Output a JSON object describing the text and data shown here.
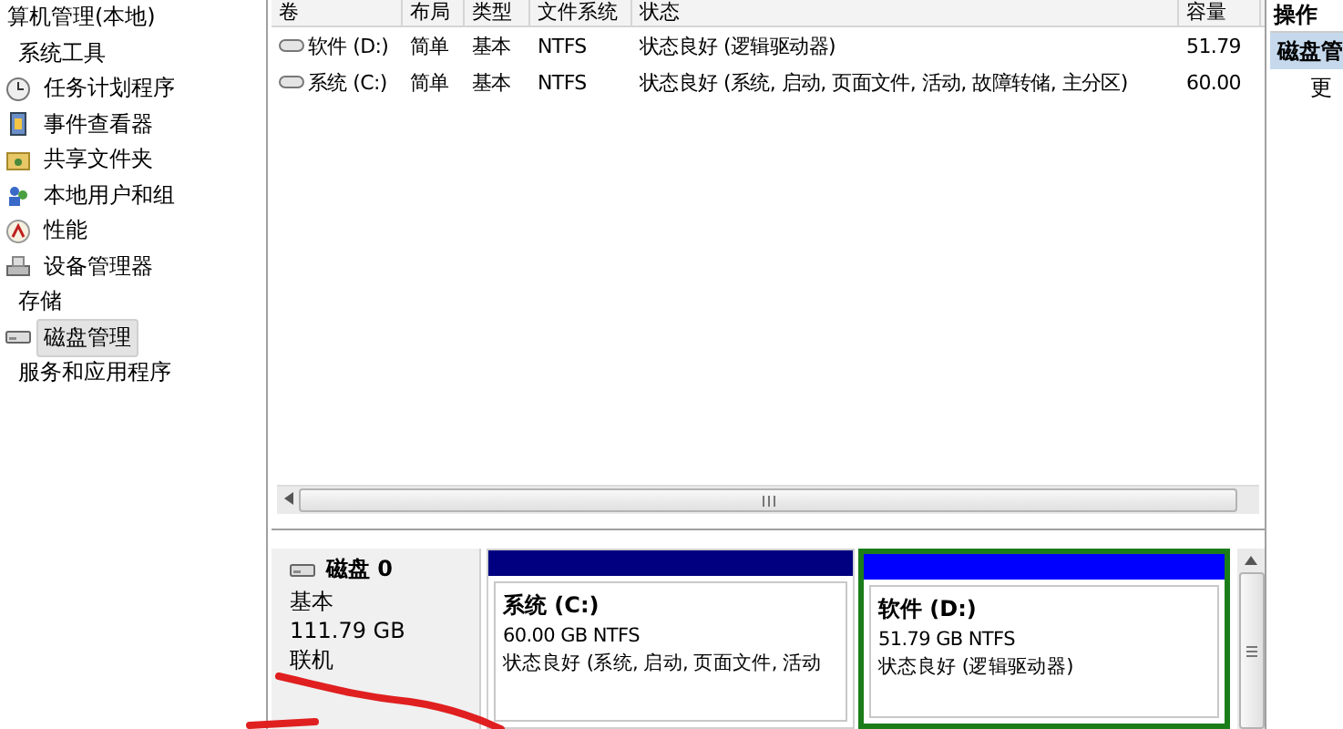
{
  "tree": [
    {
      "label": "算机管理(本地)",
      "selected": false,
      "children": [
        {
          "label": "系统工具",
          "selected": false,
          "children": [
            {
              "label": "任务计划程序",
              "selected": false
            },
            {
              "label": "事件查看器",
              "selected": false
            },
            {
              "label": "共享文件夹",
              "selected": false
            },
            {
              "label": "本地用户和组",
              "selected": false
            },
            {
              "label": "性能",
              "selected": false
            },
            {
              "label": "设备管理器",
              "selected": false
            }
          ]
        },
        {
          "label": "存储",
          "selected": false,
          "children": [
            {
              "label": "磁盘管理",
              "selected": true
            }
          ]
        },
        {
          "label": "服务和应用程序",
          "selected": false
        }
      ]
    }
  ],
  "table": {
    "columns": [
      "卷",
      "布局",
      "类型",
      "文件系统",
      "状态",
      "容量"
    ],
    "rows": [
      {
        "cells": [
          "软件 (D:)",
          "简单",
          "基本",
          "NTFS",
          "状态良好 (逻辑驱动器)",
          "51.79"
        ],
        "selected": false
      },
      {
        "cells": [
          "系统 (C:)",
          "简单",
          "基本",
          "NTFS",
          "状态良好 (系统, 启动, 页面文件, 活动, 故障转储, 主分区)",
          "60.00"
        ],
        "selected": false
      }
    ]
  },
  "disk": {
    "name": "磁盘 0",
    "type": "基本",
    "size": "111.79 GB",
    "status": "联机",
    "partitions": [
      {
        "name": "系统 (C:)",
        "size": "60.00 GB NTFS",
        "status": "状态良好 (系统, 启动, 页面文件, 活动",
        "color": "#000080",
        "selected": false
      },
      {
        "name": "软件 (D:)",
        "size": "51.79 GB NTFS",
        "status": "状态良好 (逻辑驱动器)",
        "color": "#0000ff",
        "selected": true
      }
    ]
  },
  "actions": {
    "title": "操作",
    "items": [
      {
        "label": "磁盘管",
        "selected": true
      },
      {
        "label": "更",
        "selected": false
      }
    ]
  }
}
